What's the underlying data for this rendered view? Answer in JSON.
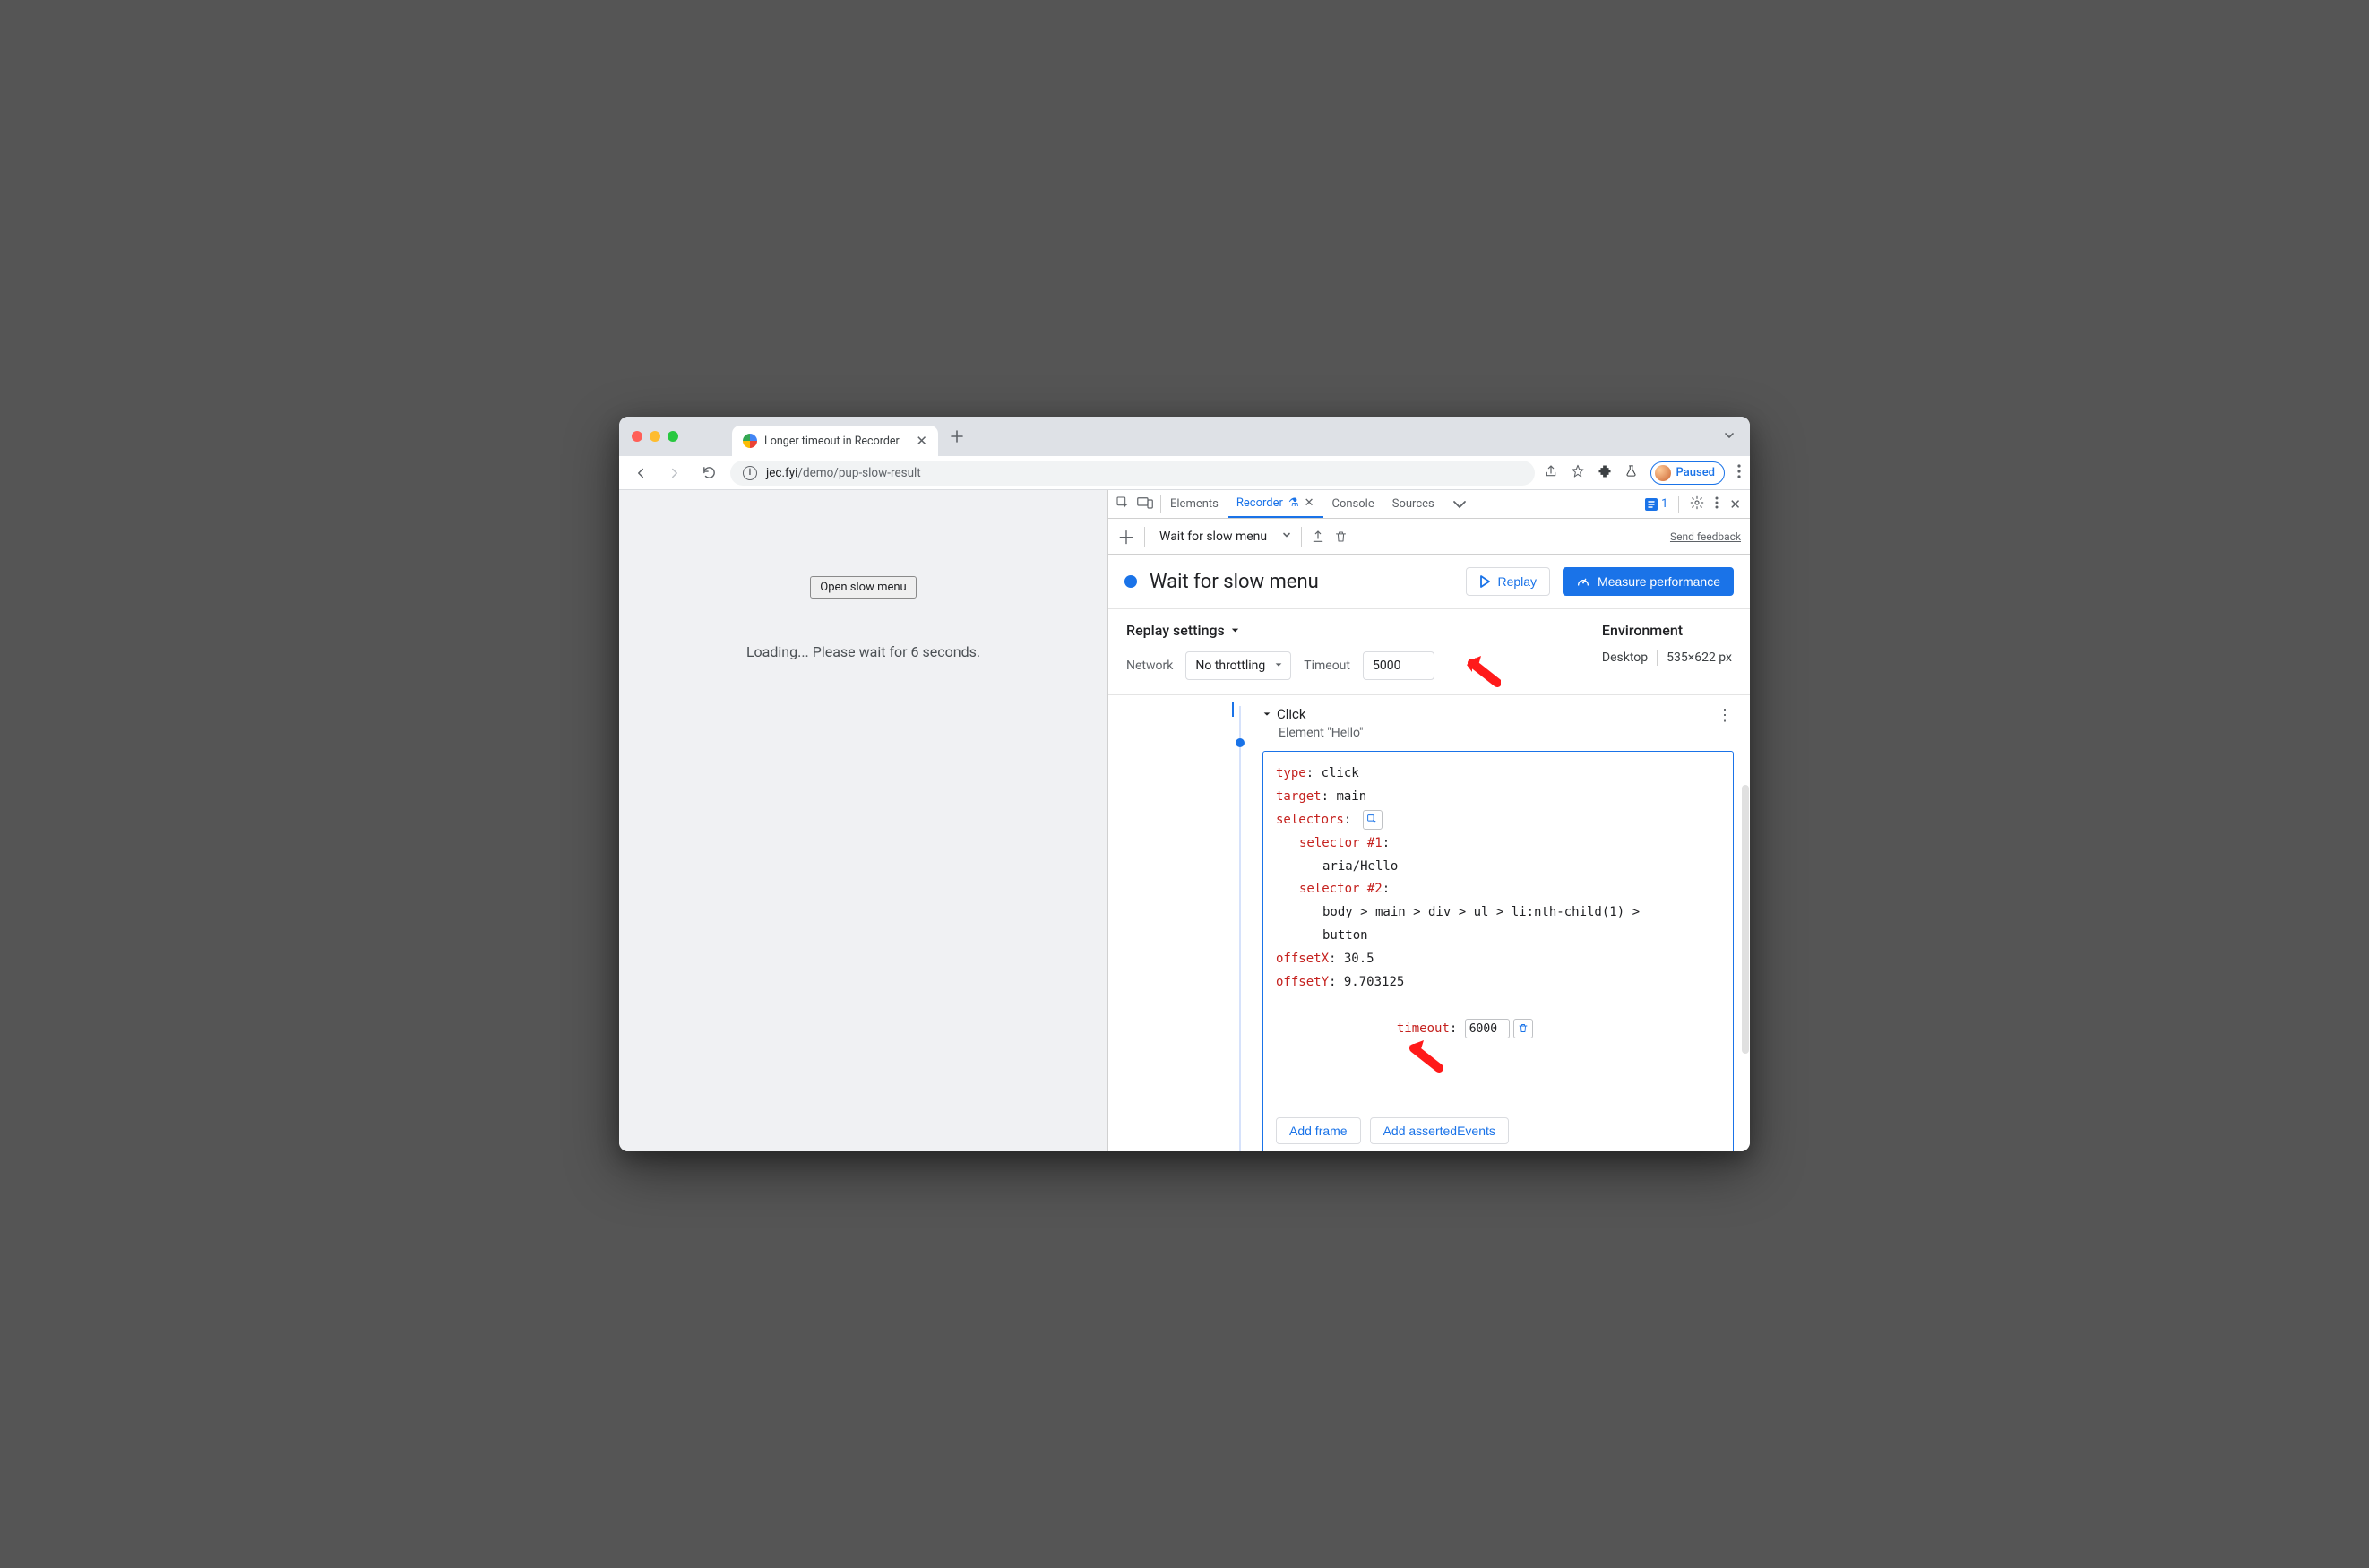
{
  "browser": {
    "tab_title": "Longer timeout in Recorder",
    "url_host": "jec.fyi",
    "url_path": "/demo/pup-slow-result",
    "profile_status": "Paused"
  },
  "page": {
    "button_label": "Open slow menu",
    "loading_text": "Loading... Please wait for 6 seconds."
  },
  "devtools": {
    "tabs": {
      "elements": "Elements",
      "recorder": "Recorder",
      "console": "Console",
      "sources": "Sources"
    },
    "issues_count": "1",
    "recorder_toolbar": {
      "recording_name": "Wait for slow menu",
      "feedback": "Send feedback"
    },
    "recording": {
      "title": "Wait for slow menu",
      "replay_btn": "Replay",
      "measure_btn": "Measure performance"
    },
    "replay_settings": {
      "title": "Replay settings",
      "network_label": "Network",
      "network_value": "No throttling",
      "timeout_label": "Timeout",
      "timeout_value": "5000"
    },
    "environment": {
      "title": "Environment",
      "device": "Desktop",
      "viewport": "535×622 px"
    },
    "step": {
      "name": "Click",
      "subtitle": "Element \"Hello\"",
      "type_key": "type",
      "type_val": "click",
      "target_key": "target",
      "target_val": "main",
      "selectors_key": "selectors",
      "sel1_key": "selector #1",
      "sel1_val": "aria/Hello",
      "sel2_key": "selector #2",
      "sel2_val_a": "body > main > div > ul > li:nth-child(1) >",
      "sel2_val_b": "button",
      "offsetX_key": "offsetX",
      "offsetX_val": "30.5",
      "offsetY_key": "offsetY",
      "offsetY_val": "9.703125",
      "timeout_key": "timeout",
      "timeout_val": "6000",
      "add_frame": "Add frame",
      "add_asserted": "Add assertedEvents"
    }
  }
}
